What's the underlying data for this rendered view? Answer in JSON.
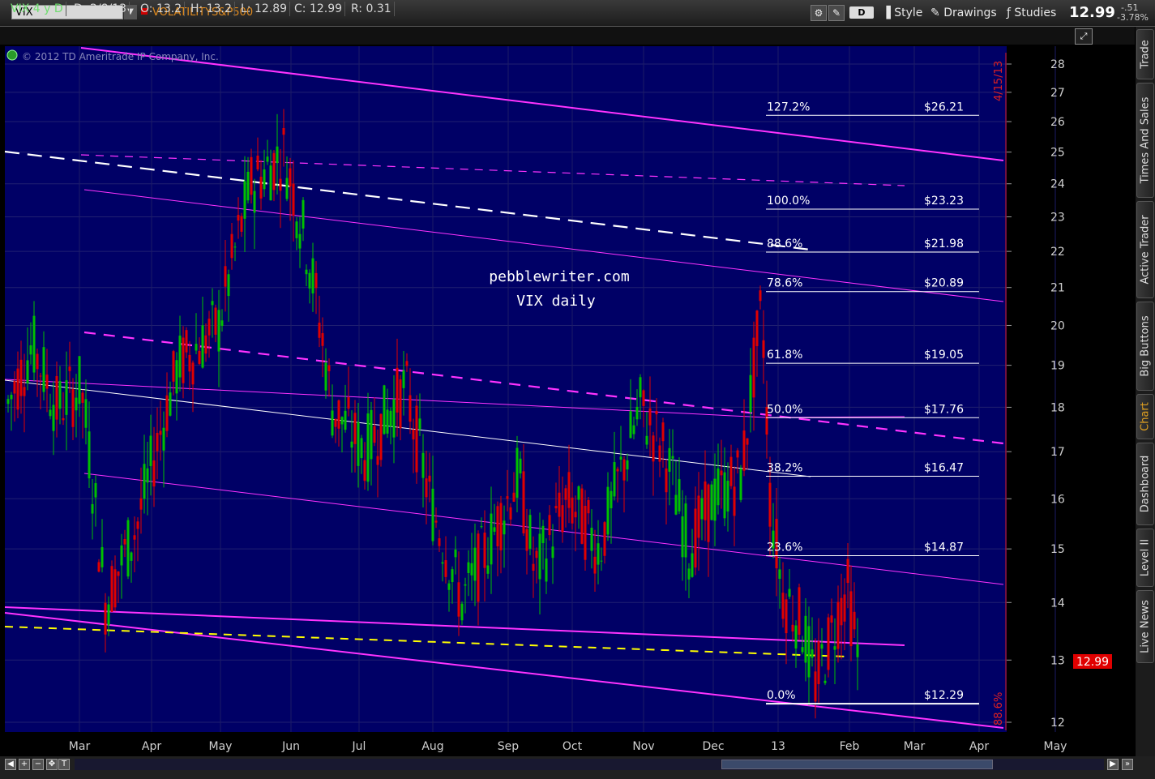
{
  "toolbar": {
    "symbol": "VIX",
    "description": "VOLATILITYS&P500",
    "period_label": "D",
    "style_label": "Style",
    "drawings_label": "Drawings",
    "studies_label": "Studies",
    "last_price": "12.99",
    "change": "-.51",
    "change_pct": "-3.78%"
  },
  "info": {
    "symbol_period": "VIX 4 y D",
    "date": "D: 2/8/13",
    "open": "O: 13.2",
    "high": "H: 13.2",
    "low": "L: 12.89",
    "close": "C: 12.99",
    "range": "R: 0.31"
  },
  "side_tabs": [
    "Trade",
    "Times And Sales",
    "Active Trader",
    "Big Buttons",
    "Chart",
    "Dashboard",
    "Level II",
    "Live News"
  ],
  "active_tab": "Chart",
  "chart_data": {
    "type": "candlestick",
    "copyright": "2012 © TD Ameritrade IP Company, Inc.",
    "watermark": [
      "pebblewriter.com",
      "VIX daily"
    ],
    "y_ticks": [
      12,
      13,
      14,
      15,
      16,
      17,
      18,
      19,
      20,
      21,
      22,
      23,
      24,
      25,
      26,
      27,
      28
    ],
    "x_labels": [
      "Mar",
      "Apr",
      "May",
      "Jun",
      "Jul",
      "Aug",
      "Sep",
      "Oct",
      "Nov",
      "Dec",
      "13",
      "Feb",
      "Mar",
      "Apr",
      "May"
    ],
    "fib_levels": [
      {
        "pct": "127.2%",
        "price": "$26.21",
        "value": 26.21
      },
      {
        "pct": "100.0%",
        "price": "$23.23",
        "value": 23.23
      },
      {
        "pct": "88.6%",
        "price": "$21.98",
        "value": 21.98
      },
      {
        "pct": "78.6%",
        "price": "$20.89",
        "value": 20.89
      },
      {
        "pct": "61.8%",
        "price": "$19.05",
        "value": 19.05
      },
      {
        "pct": "50.0%",
        "price": "$17.76",
        "value": 17.76
      },
      {
        "pct": "38.2%",
        "price": "$16.47",
        "value": 16.47
      },
      {
        "pct": "23.6%",
        "price": "$14.87",
        "value": 14.87
      },
      {
        "pct": "0.0%",
        "price": "$12.29",
        "value": 12.29
      }
    ],
    "vertical_label_top": "4/15/13",
    "vertical_label_bottom": "88.6%",
    "price_tag": "12.99",
    "colors": {
      "background": "#000066",
      "up": "#00c000",
      "down": "#e00000",
      "trend": "#ff33ff",
      "yellow": "#ffff00",
      "white": "#ffffff"
    }
  }
}
